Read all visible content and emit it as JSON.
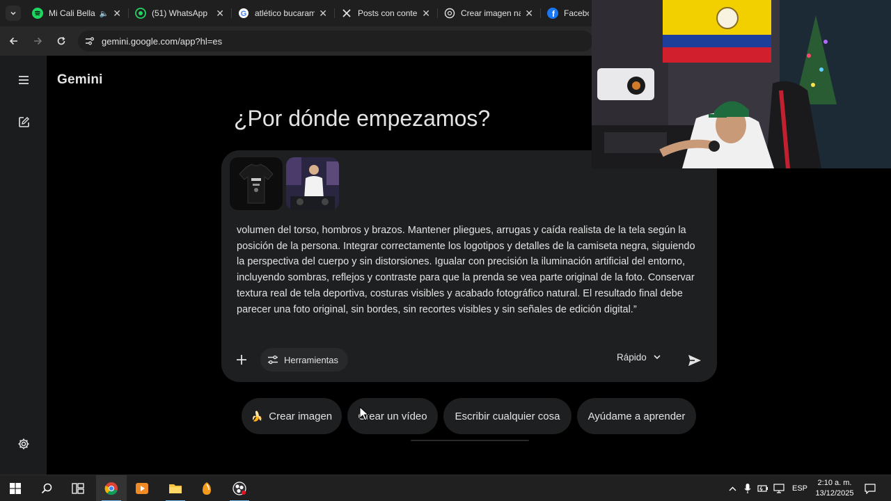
{
  "browser": {
    "tabs": [
      {
        "label": "Mi Cali Bella",
        "icon": "spotify-icon",
        "audio": true
      },
      {
        "label": "(51) WhatsApp",
        "icon": "whatsapp-icon",
        "audio": false
      },
      {
        "label": "atlético bucaram",
        "icon": "google-icon",
        "audio": false
      },
      {
        "label": "Posts con conten",
        "icon": "x-icon",
        "audio": false
      },
      {
        "label": "Crear imagen na",
        "icon": "chatgpt-icon",
        "audio": false
      },
      {
        "label": "Faceboo",
        "icon": "facebook-icon",
        "audio": false
      }
    ],
    "url": "gemini.google.com/app?hl=es"
  },
  "app": {
    "title": "Gemini",
    "hero": "¿Por dónde empezamos?",
    "prompt_text": "volumen del torso, hombros y brazos. Mantener pliegues, arrugas y caída realista de la tela según la posición de la persona. Integrar correctamente los logotipos y detalles de la camiseta negra, siguiendo la perspectiva del cuerpo y sin distorsiones. Igualar con precisión la iluminación artificial del entorno, incluyendo sombras, reflejos y contraste para que la prenda se vea parte original de la foto. Conservar textura real de tela deportiva, costuras visibles y acabado fotográfico natural. El resultado final debe parecer una foto original, sin bordes, sin recortes visibles y sin señales de edición digital.”",
    "tools_label": "Herramientas",
    "model_label": "Rápido",
    "chips": [
      {
        "emoji": "🍌",
        "label": "Crear imagen"
      },
      {
        "emoji": "",
        "label": "Crear un vídeo"
      },
      {
        "emoji": "",
        "label": "Escribir cualquier cosa"
      },
      {
        "emoji": "",
        "label": "Ayúdame a aprender"
      }
    ]
  },
  "taskbar": {
    "language": "ESP",
    "time": "2:10 a. m.",
    "date": "13/12/2025"
  },
  "colors": {
    "background": "#000000",
    "composer": "#1e1f20",
    "text": "#e3e3e3",
    "taskbar": "#202020"
  }
}
